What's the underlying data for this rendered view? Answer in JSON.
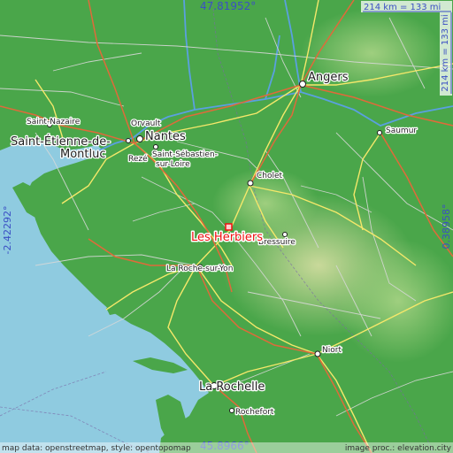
{
  "place_name": "Les Herbiers",
  "coordinates": {
    "top": "47.81952°",
    "bottom": "45.8966°",
    "left": "-2.42292°",
    "right": "0.38958°"
  },
  "scale": {
    "horizontal": "214 km = 133 mi",
    "vertical": "214 km = 133 mi"
  },
  "attribution": {
    "left": "map data: openstreetmap, style: opentopomap",
    "right": "image proc.: elevation.city"
  },
  "cities": [
    {
      "name": "Angers"
    },
    {
      "name": "Saint-Nazaire"
    },
    {
      "name": "Orvault"
    },
    {
      "name": "Nantes"
    },
    {
      "name": "Saint-Étienne-de-"
    },
    {
      "name": "Montluc"
    },
    {
      "name": "Rezé"
    },
    {
      "name": "Saint-Sébastien-"
    },
    {
      "name": "sur-Loire"
    },
    {
      "name": "Cholet"
    },
    {
      "name": "Saumur"
    },
    {
      "name": "La Roche-sur-Yon"
    },
    {
      "name": "Niort"
    },
    {
      "name": "La Rochelle"
    },
    {
      "name": "Rochefort"
    },
    {
      "name": "Bressuire"
    }
  ],
  "colors": {
    "sea": "#8fcbe0",
    "land": "#4aa64a",
    "highlight": "#ee1111",
    "coordinate_text": "#3b4fc4"
  }
}
